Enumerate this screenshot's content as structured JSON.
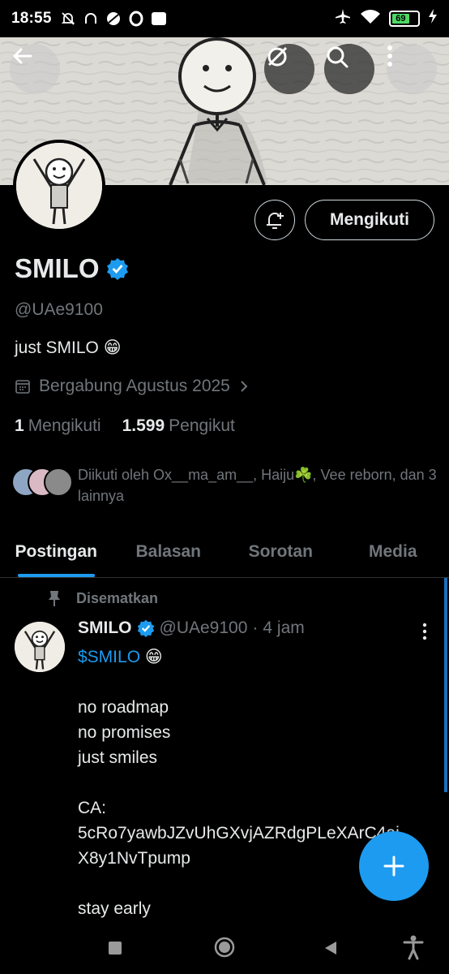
{
  "status_bar": {
    "time": "18:55",
    "battery_level": "69",
    "left_icons": [
      "notifications-off-icon",
      "headphones-icon",
      "vpn-icon",
      "opera-icon",
      "ad-blocker-icon"
    ],
    "right_icons": [
      "airplane-mode-icon",
      "wifi-icon",
      "battery-icon",
      "charging-icon"
    ],
    "ad_badge": "AD"
  },
  "header": {
    "back_icon": "arrow-left-icon",
    "grok_icon": "grok-icon",
    "search_icon": "search-icon",
    "more_icon": "more-vertical-icon"
  },
  "profile": {
    "name": "SMILO",
    "verified": true,
    "handle": "@UAe9100",
    "bio": "just SMILO 😁",
    "joined": "Bergabung Agustus 2025",
    "following_count": "1",
    "following_label": "Mengikuti",
    "followers_count": "1.599",
    "followers_label": "Pengikut",
    "followed_by": "Diikuti oleh Ox__ma_am__, Haiju☘️, Vee reborn, dan 3 lainnya",
    "follow_button_label": "Mengikuti",
    "accent_color": "#1d9bf0"
  },
  "tabs": [
    {
      "label": "Postingan",
      "active": true
    },
    {
      "label": "Balasan",
      "active": false
    },
    {
      "label": "Sorotan",
      "active": false
    },
    {
      "label": "Media",
      "active": false
    }
  ],
  "pinned_post": {
    "pinned_label": "Disematkan",
    "author_name": "SMILO",
    "author_handle": "@UAe9100",
    "separator": "·",
    "time": "4 jam",
    "cashtag": "$SMILO",
    "emoji": "😁",
    "lines": [
      "no roadmap",
      "no promises",
      "just smiles"
    ],
    "ca_label": "CA:",
    "ca_value_1": "5cRo7yawbJZvUhGXvjAZRdgPLeXArC4ai",
    "ca_value_2": "X8y1NvTpump",
    "closing": "stay early"
  },
  "fab": {
    "icon": "plus-icon"
  },
  "nav_bar": {
    "icons": [
      "recents-square-icon",
      "home-circle-icon",
      "back-triangle-icon",
      "accessibility-icon"
    ]
  }
}
